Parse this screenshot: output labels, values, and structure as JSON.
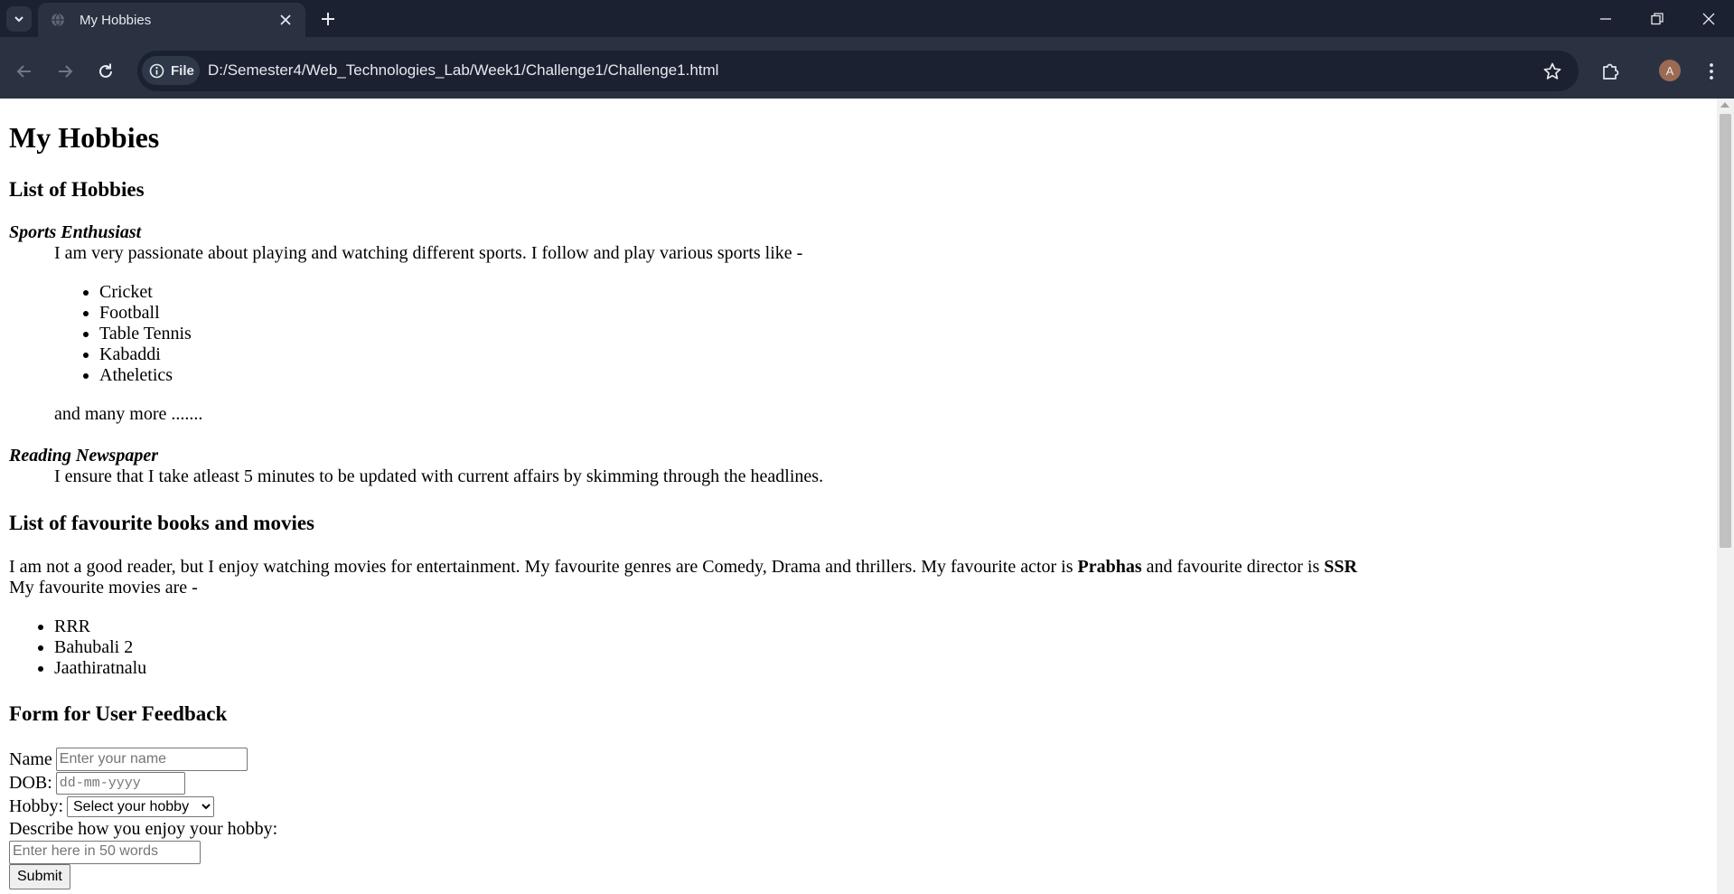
{
  "browser": {
    "tab_title": "My Hobbies",
    "site_chip_label": "File",
    "url": "D:/Semester4/Web_Technologies_Lab/Week1/Challenge1/Challenge1.html",
    "avatar_letter": "A",
    "icons": {
      "tab_menu": "chevron-down-icon",
      "favicon": "globe-icon",
      "tab_close": "close-icon",
      "new_tab": "plus-icon",
      "minimize": "minimize-icon",
      "restore": "restore-icon",
      "close_window": "close-icon",
      "back": "back-arrow-icon",
      "forward": "forward-arrow-icon",
      "reload": "reload-icon",
      "info": "info-icon",
      "bookmark": "star-icon",
      "extensions": "puzzle-icon",
      "menu": "kebab-menu-icon"
    },
    "colors": {
      "tab_strip": "#1b2130",
      "toolbar": "#2a3242",
      "omnibox": "#1b2130"
    }
  },
  "page": {
    "title": "My Hobbies",
    "hobbies_heading": "List of Hobbies",
    "hobbies": [
      {
        "term": "Sports Enthusiast",
        "description": "I am very passionate about playing and watching different sports. I follow and play various sports like -",
        "items": [
          "Cricket",
          "Football",
          "Table Tennis",
          "Kabaddi",
          "Atheletics"
        ],
        "closing": "and many more ......."
      },
      {
        "term": "Reading Newspaper",
        "description": "I ensure that I take atleast 5 minutes to be updated with current affairs by skimming through the headlines."
      }
    ],
    "favourites_heading": "List of favourite books and movies",
    "favourites_text_1": "I am not a good reader, but I enjoy watching movies for entertainment. My favourite genres are Comedy, Drama and thrillers. My favourite actor is ",
    "favourite_actor": "Prabhas",
    "favourites_text_2": " and favourite director is ",
    "favourite_director": "SSR",
    "movies_intro": "My favourite movies are -",
    "movies": [
      "RRR",
      "Bahubali 2",
      "Jaathiratnalu"
    ],
    "form_heading": "Form for User Feedback",
    "form": {
      "name_label": "Name",
      "name_placeholder": "Enter your name",
      "dob_label": "DOB:",
      "dob_placeholder": "dd-mm-yyyy",
      "hobby_label": "Hobby:",
      "hobby_selected": "Select your hobby",
      "describe_label": "Describe how you enjoy your hobby:",
      "describe_placeholder": "Enter here in 50 words",
      "submit_label": "Submit"
    }
  }
}
